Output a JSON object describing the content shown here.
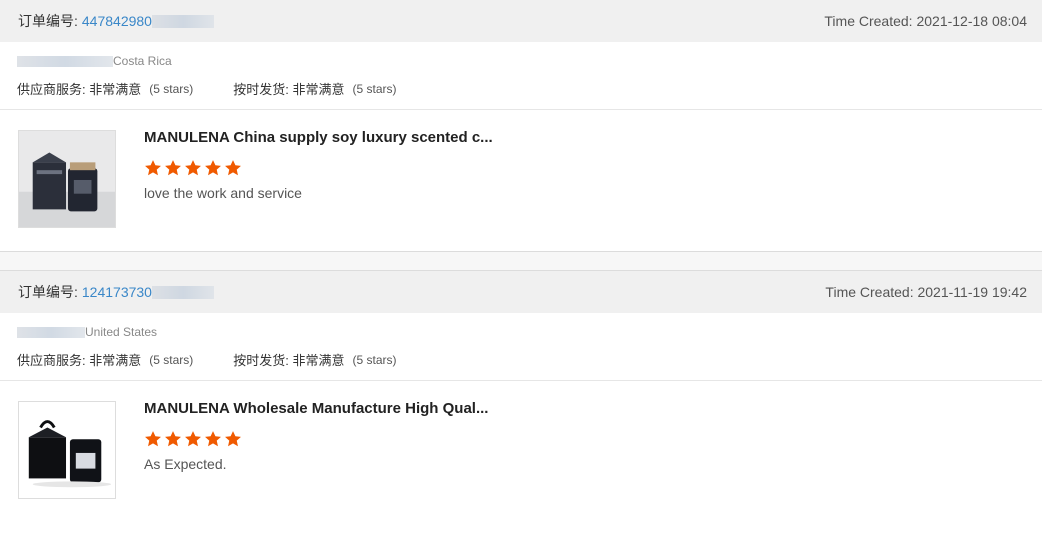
{
  "orders": [
    {
      "order_label": "订单编号:",
      "order_id": "447842980",
      "time_created": "Time Created: 2021-12-18 08:04",
      "buyer_country": "Costa Rica",
      "supplier_service_label": "供应商服务:",
      "supplier_service_value": "非常满意",
      "supplier_service_stars": "(5 stars)",
      "shipping_label": "按时发货:",
      "shipping_value": "非常满意",
      "shipping_stars": "(5 stars)",
      "product_title": "MANULENA China supply soy luxury scented c...",
      "rating": 5,
      "comment": "love the work and service"
    },
    {
      "order_label": "订单编号:",
      "order_id": "124173730",
      "time_created": "Time Created: 2021-11-19 19:42",
      "buyer_country": "United States",
      "supplier_service_label": "供应商服务:",
      "supplier_service_value": "非常满意",
      "supplier_service_stars": "(5 stars)",
      "shipping_label": "按时发货:",
      "shipping_value": "非常满意",
      "shipping_stars": "(5 stars)",
      "product_title": "MANULENA Wholesale Manufacture High Qual...",
      "rating": 5,
      "comment": "As Expected."
    }
  ],
  "colors": {
    "link": "#3a87c8",
    "star": "#f05a00",
    "header_bg": "#f0f0f0"
  },
  "icons": {
    "star": "star-icon"
  }
}
